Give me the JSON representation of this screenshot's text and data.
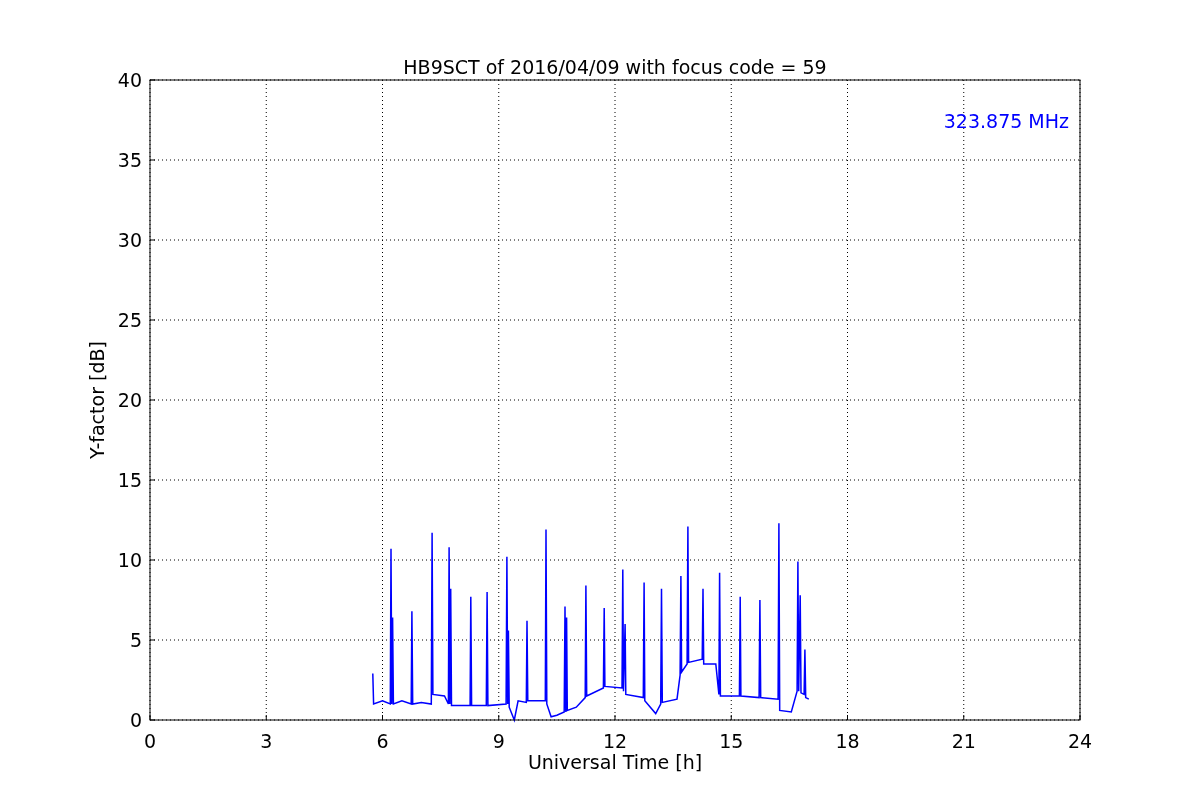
{
  "figure": {
    "chart_data": {
      "type": "line",
      "title": "HB9SCT of 2016/04/09 with focus code = 59",
      "xlabel": "Universal Time [h]",
      "ylabel": "Y-factor [dB]",
      "xlim": [
        0,
        24
      ],
      "ylim": [
        0,
        40
      ],
      "xticks": [
        0,
        3,
        6,
        9,
        12,
        15,
        18,
        21,
        24
      ],
      "yticks": [
        0,
        5,
        10,
        15,
        20,
        25,
        30,
        35,
        40
      ],
      "grid": true,
      "annotations": [
        "323.875 MHz"
      ],
      "x": [
        5.75,
        5.77,
        6.0,
        6.2,
        6.22,
        6.24,
        6.26,
        6.28,
        6.5,
        6.74,
        6.76,
        6.78,
        7.0,
        7.26,
        7.28,
        7.3,
        7.6,
        7.7,
        7.72,
        7.74,
        7.76,
        7.78,
        8.26,
        8.28,
        8.3,
        8.68,
        8.7,
        8.72,
        9.19,
        9.21,
        9.23,
        9.25,
        9.27,
        9.4,
        9.5,
        9.71,
        9.73,
        9.75,
        10.2,
        10.22,
        10.24,
        10.35,
        10.5,
        10.69,
        10.71,
        10.73,
        10.75,
        10.77,
        11.0,
        11.23,
        11.25,
        11.27,
        11.7,
        11.72,
        11.74,
        12.18,
        12.2,
        12.22,
        12.26,
        12.28,
        12.73,
        12.75,
        12.77,
        13.05,
        13.18,
        13.2,
        13.22,
        13.6,
        13.68,
        13.7,
        13.72,
        13.86,
        13.88,
        13.9,
        14.25,
        14.27,
        14.29,
        14.6,
        14.68,
        14.7,
        14.72,
        15.21,
        15.23,
        15.25,
        15.72,
        15.74,
        15.76,
        16.21,
        16.23,
        16.25,
        16.55,
        16.7,
        16.72,
        16.74,
        16.78,
        16.8,
        16.88,
        16.9,
        16.92,
        17.0
      ],
      "series": [
        {
          "color": "#0000ff",
          "values": [
            2.9,
            1.0,
            1.2,
            1.0,
            10.7,
            1.0,
            6.4,
            1.0,
            1.2,
            1.0,
            6.8,
            1.0,
            1.1,
            1.0,
            11.7,
            1.6,
            1.5,
            1.0,
            10.8,
            1.0,
            8.2,
            0.9,
            0.9,
            7.7,
            0.9,
            0.9,
            8.0,
            0.9,
            1.0,
            10.2,
            1.0,
            5.6,
            0.8,
            0.0,
            1.2,
            1.1,
            6.2,
            1.2,
            1.2,
            11.9,
            1.0,
            0.2,
            0.3,
            0.5,
            7.1,
            0.5,
            6.4,
            0.6,
            0.8,
            1.4,
            8.4,
            1.5,
            2.0,
            7.0,
            2.1,
            2.0,
            9.4,
            1.8,
            6.0,
            1.6,
            1.4,
            8.6,
            1.2,
            0.4,
            1.0,
            8.2,
            1.1,
            1.3,
            2.8,
            9.0,
            3.0,
            3.5,
            12.1,
            3.6,
            3.8,
            8.2,
            3.5,
            3.5,
            1.6,
            9.2,
            1.5,
            1.5,
            7.7,
            1.5,
            1.4,
            7.5,
            1.4,
            1.3,
            12.3,
            0.6,
            0.5,
            1.8,
            9.9,
            1.8,
            7.8,
            1.7,
            1.6,
            4.4,
            1.4,
            1.3
          ]
        }
      ]
    }
  }
}
